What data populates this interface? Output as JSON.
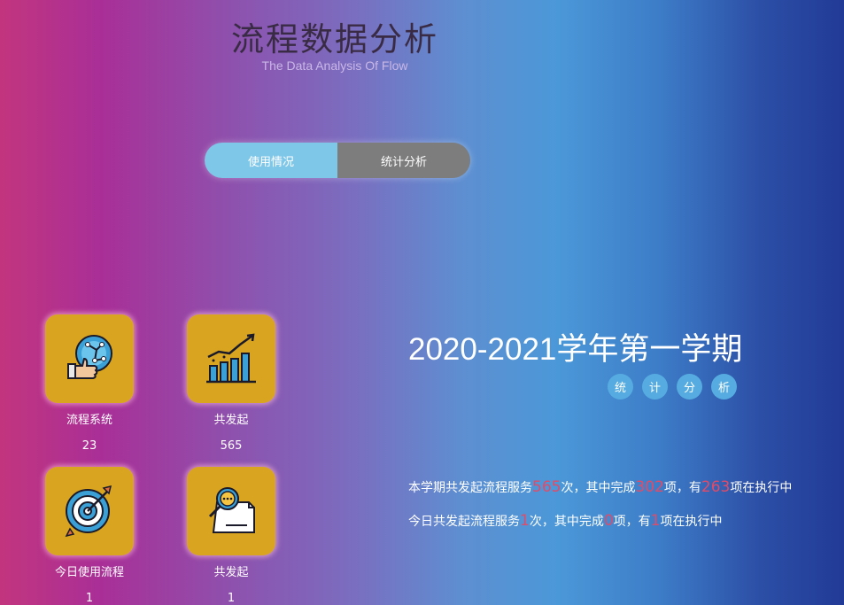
{
  "header": {
    "title_cn": "流程数据分析",
    "title_en": "The Data Analysis Of Flow"
  },
  "tabs": [
    {
      "label": "使用情况",
      "active": true
    },
    {
      "label": "统计分析",
      "active": false
    }
  ],
  "cards": [
    {
      "label": "流程系统",
      "value": "23",
      "icon": "globe-thumbs-up-icon"
    },
    {
      "label": "共发起",
      "value": "565",
      "icon": "growth-bar-chart-icon"
    },
    {
      "label": "今日使用流程",
      "value": "1",
      "icon": "target-arrow-icon"
    },
    {
      "label": "共发起",
      "value": "1",
      "icon": "magnifier-document-icon"
    }
  ],
  "semester": {
    "title": "2020-2021学年第一学期",
    "badges": [
      "统",
      "计",
      "分",
      "析"
    ]
  },
  "summary": {
    "term": {
      "prefix": "本学期共发起流程服务",
      "total": "565",
      "mid1": "次，其中完成",
      "done": "302",
      "mid2": "项，有",
      "running": "263",
      "suffix": "项在执行中"
    },
    "today": {
      "prefix": "今日共发起流程服务",
      "total": "1",
      "mid1": "次，其中完成",
      "done": "0",
      "mid2": "项，有",
      "running": "1",
      "suffix": "项在执行中"
    }
  },
  "colors": {
    "card_bg": "#d9a520",
    "tab_active": "#7fc7e8",
    "tab_inactive": "#7d7d7d",
    "highlight_num": "#e24b67",
    "badge_bg": "#56ace0"
  }
}
